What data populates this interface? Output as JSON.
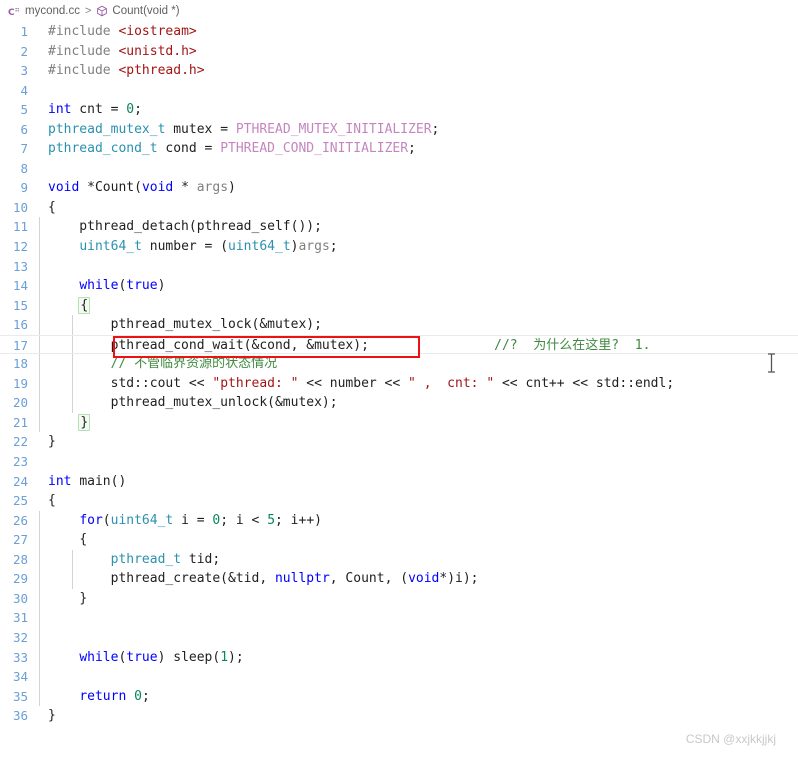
{
  "breadcrumb": {
    "file_icon": "cpp-file-icon",
    "file": "mycond.cc",
    "separator": ">",
    "symbol_icon": "method-cube-icon",
    "symbol": "Count(void *)"
  },
  "watermark": "CSDN @xxjkkjjkj",
  "colors": {
    "line_number": "#6a9fd8",
    "keyword": "#0000ff",
    "type": "#2b91af",
    "string": "#a31515",
    "macro": "#c586c0",
    "comment": "#3f8a3f",
    "number": "#098658",
    "preprocessor": "#808080",
    "annotation_box": "#ee1111",
    "background": "#ffffff"
  },
  "annotation": {
    "name": "red-highlight-rectangle",
    "target_line": 17,
    "border_color": "#ee1111"
  },
  "editor": {
    "active_line": 17,
    "total_lines": 36,
    "lines": [
      {
        "n": "1",
        "text": "#include <iostream>"
      },
      {
        "n": "2",
        "text": "#include <unistd.h>"
      },
      {
        "n": "3",
        "text": "#include <pthread.h>"
      },
      {
        "n": "4",
        "text": ""
      },
      {
        "n": "5",
        "text": "int cnt = 0;"
      },
      {
        "n": "6",
        "text": "pthread_mutex_t mutex = PTHREAD_MUTEX_INITIALIZER;"
      },
      {
        "n": "7",
        "text": "pthread_cond_t cond = PTHREAD_COND_INITIALIZER;"
      },
      {
        "n": "8",
        "text": ""
      },
      {
        "n": "9",
        "text": "void *Count(void * args)"
      },
      {
        "n": "10",
        "text": "{"
      },
      {
        "n": "11",
        "text": "    pthread_detach(pthread_self());"
      },
      {
        "n": "12",
        "text": "    uint64_t number = (uint64_t)args;"
      },
      {
        "n": "13",
        "text": ""
      },
      {
        "n": "14",
        "text": "    while(true)"
      },
      {
        "n": "15",
        "text": "    {"
      },
      {
        "n": "16",
        "text": "        pthread_mutex_lock(&mutex);"
      },
      {
        "n": "17",
        "text": "        pthread_cond_wait(&cond, &mutex);                //?  为什么在这里?  1."
      },
      {
        "n": "18",
        "text": "        // 不管临界资源的状态情况"
      },
      {
        "n": "19",
        "text": "        std::cout << \"pthread: \" << number << \" ,  cnt: \" << cnt++ << std::endl;"
      },
      {
        "n": "20",
        "text": "        pthread_mutex_unlock(&mutex);"
      },
      {
        "n": "21",
        "text": "    }"
      },
      {
        "n": "22",
        "text": "}"
      },
      {
        "n": "23",
        "text": ""
      },
      {
        "n": "24",
        "text": "int main()"
      },
      {
        "n": "25",
        "text": "{"
      },
      {
        "n": "26",
        "text": "    for(uint64_t i = 0; i < 5; i++)"
      },
      {
        "n": "27",
        "text": "    {"
      },
      {
        "n": "28",
        "text": "        pthread_t tid;"
      },
      {
        "n": "29",
        "text": "        pthread_create(&tid, nullptr, Count, (void*)i);"
      },
      {
        "n": "30",
        "text": "    }"
      },
      {
        "n": "31",
        "text": ""
      },
      {
        "n": "32",
        "text": ""
      },
      {
        "n": "33",
        "text": "    while(true) sleep(1);"
      },
      {
        "n": "34",
        "text": ""
      },
      {
        "n": "35",
        "text": "    return 0;"
      },
      {
        "n": "36",
        "text": "}"
      }
    ],
    "comments": {
      "line17_trailing": "//?  为什么在这里?  1.",
      "line18": "// 不管临界资源的状态情况"
    },
    "strings": {
      "s1": "\"pthread: \"",
      "s2": "\" ,  cnt: \""
    }
  }
}
